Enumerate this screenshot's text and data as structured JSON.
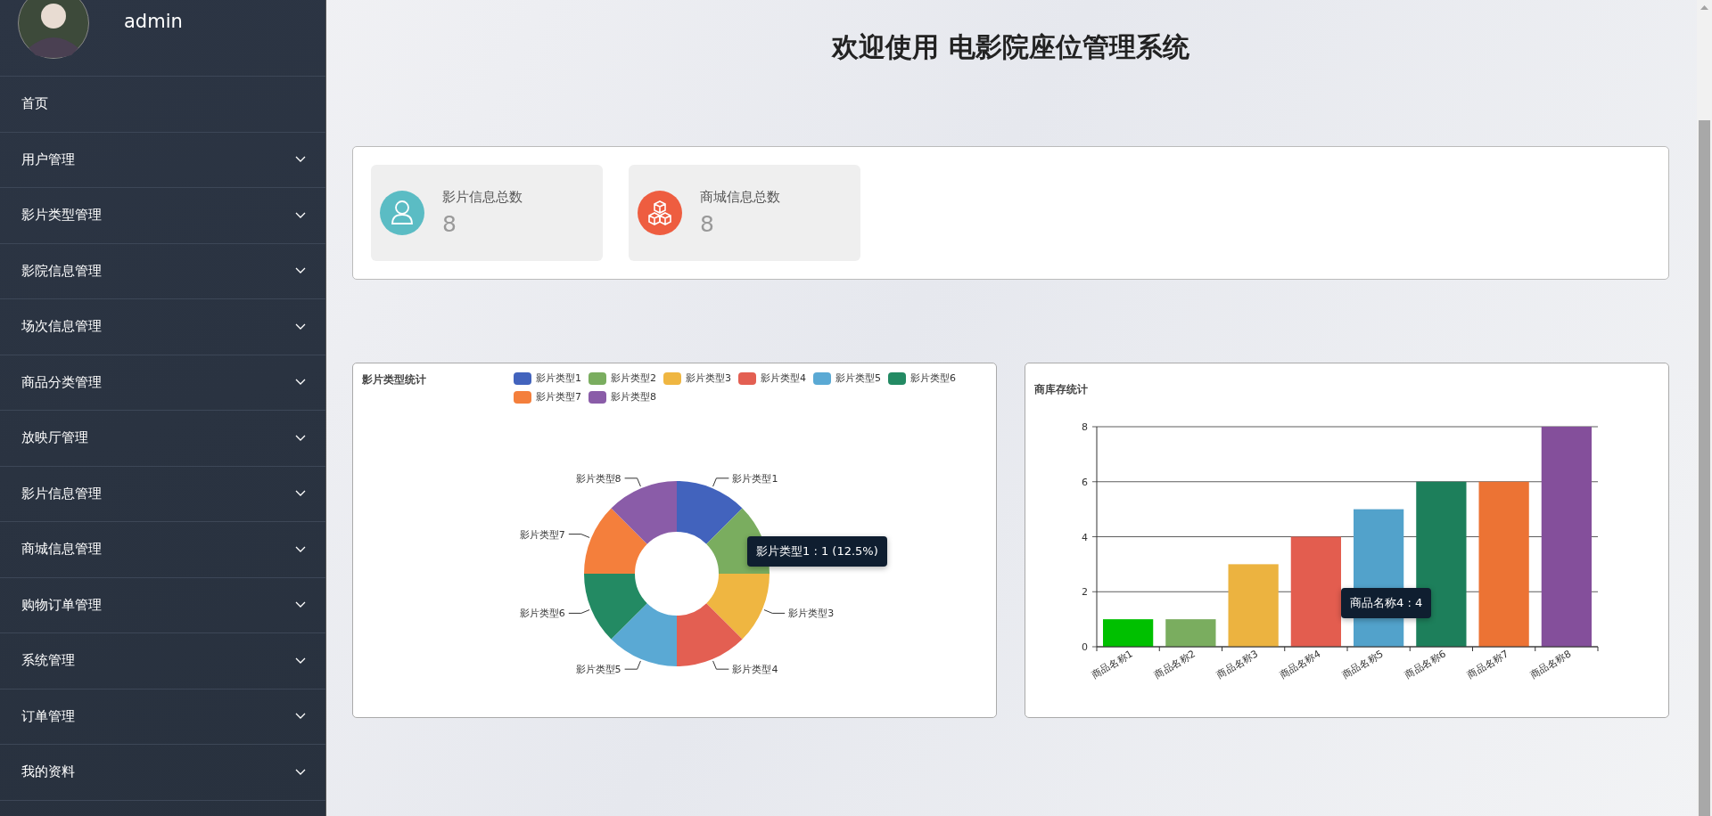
{
  "sidebar": {
    "user": {
      "name": "admin"
    },
    "items": [
      {
        "label": "首页",
        "kind": "link"
      },
      {
        "label": "用户管理",
        "kind": "submenu"
      },
      {
        "label": "影片类型管理",
        "kind": "submenu"
      },
      {
        "label": "影院信息管理",
        "kind": "submenu"
      },
      {
        "label": "场次信息管理",
        "kind": "submenu"
      },
      {
        "label": "商品分类管理",
        "kind": "submenu"
      },
      {
        "label": "放映厅管理",
        "kind": "submenu"
      },
      {
        "label": "影片信息管理",
        "kind": "submenu"
      },
      {
        "label": "商城信息管理",
        "kind": "submenu"
      },
      {
        "label": "购物订单管理",
        "kind": "submenu"
      },
      {
        "label": "系统管理",
        "kind": "submenu"
      },
      {
        "label": "订单管理",
        "kind": "submenu"
      },
      {
        "label": "我的资料",
        "kind": "submenu"
      }
    ]
  },
  "title": "欢迎使用 电影院座位管理系统",
  "stats": [
    {
      "label": "影片信息总数",
      "value": "8",
      "kind": "person",
      "color": "#5bbcc4"
    },
    {
      "label": "商城信息总数",
      "value": "8",
      "kind": "cubes",
      "color": "#ee5d40"
    }
  ],
  "charts": [
    {
      "title": "影片类型统计",
      "tooltip": "影片类型1 : 1 (12.5%)",
      "slice_labels": [
        {
          "text": "影片类型1",
          "covered": false
        },
        {
          "covered": true
        },
        {
          "text": "影片类型3",
          "covered": false
        },
        {
          "text": "影片类型4",
          "covered": false
        },
        {
          "text": "影片类型5",
          "covered": false
        },
        {
          "text": "影片类型6",
          "covered": false
        },
        {
          "text": "影片类型7",
          "covered": false
        },
        {
          "text": "影片类型8",
          "covered": false
        }
      ],
      "chart_data": {
        "type": "donut",
        "categories": [
          "影片类型1",
          "影片类型2",
          "影片类型3",
          "影片类型4",
          "影片类型5",
          "影片类型6",
          "影片类型7",
          "影片类型8"
        ],
        "values": [
          1,
          1,
          1,
          1,
          1,
          1,
          1,
          1
        ],
        "colors": [
          "#4263bd",
          "#7aad5f",
          "#efb641",
          "#e35f52",
          "#5aa9d4",
          "#238a63",
          "#f47f3c",
          "#8a5ca8"
        ]
      }
    },
    {
      "title": "商库存统计",
      "tooltip": "商品名称4 : 4",
      "chart_data": {
        "type": "bar",
        "categories": [
          "商品名称1",
          "商品名称2",
          "商品名称3",
          "商品名称4",
          "商品名称5",
          "商品名称6",
          "商品名称7",
          "商品名称8"
        ],
        "values": [
          1,
          1,
          3,
          4,
          5,
          6,
          6,
          8
        ],
        "grid": true,
        "colors": [
          "#00c000",
          "#7aad5f",
          "#ecb340",
          "#e35d4f",
          "#52a2cb",
          "#1d7f5b",
          "#ec7334",
          "#844f9b"
        ],
        "ylim": [
          0,
          8
        ],
        "yticks": [
          0,
          2,
          4,
          6,
          8
        ]
      }
    }
  ]
}
